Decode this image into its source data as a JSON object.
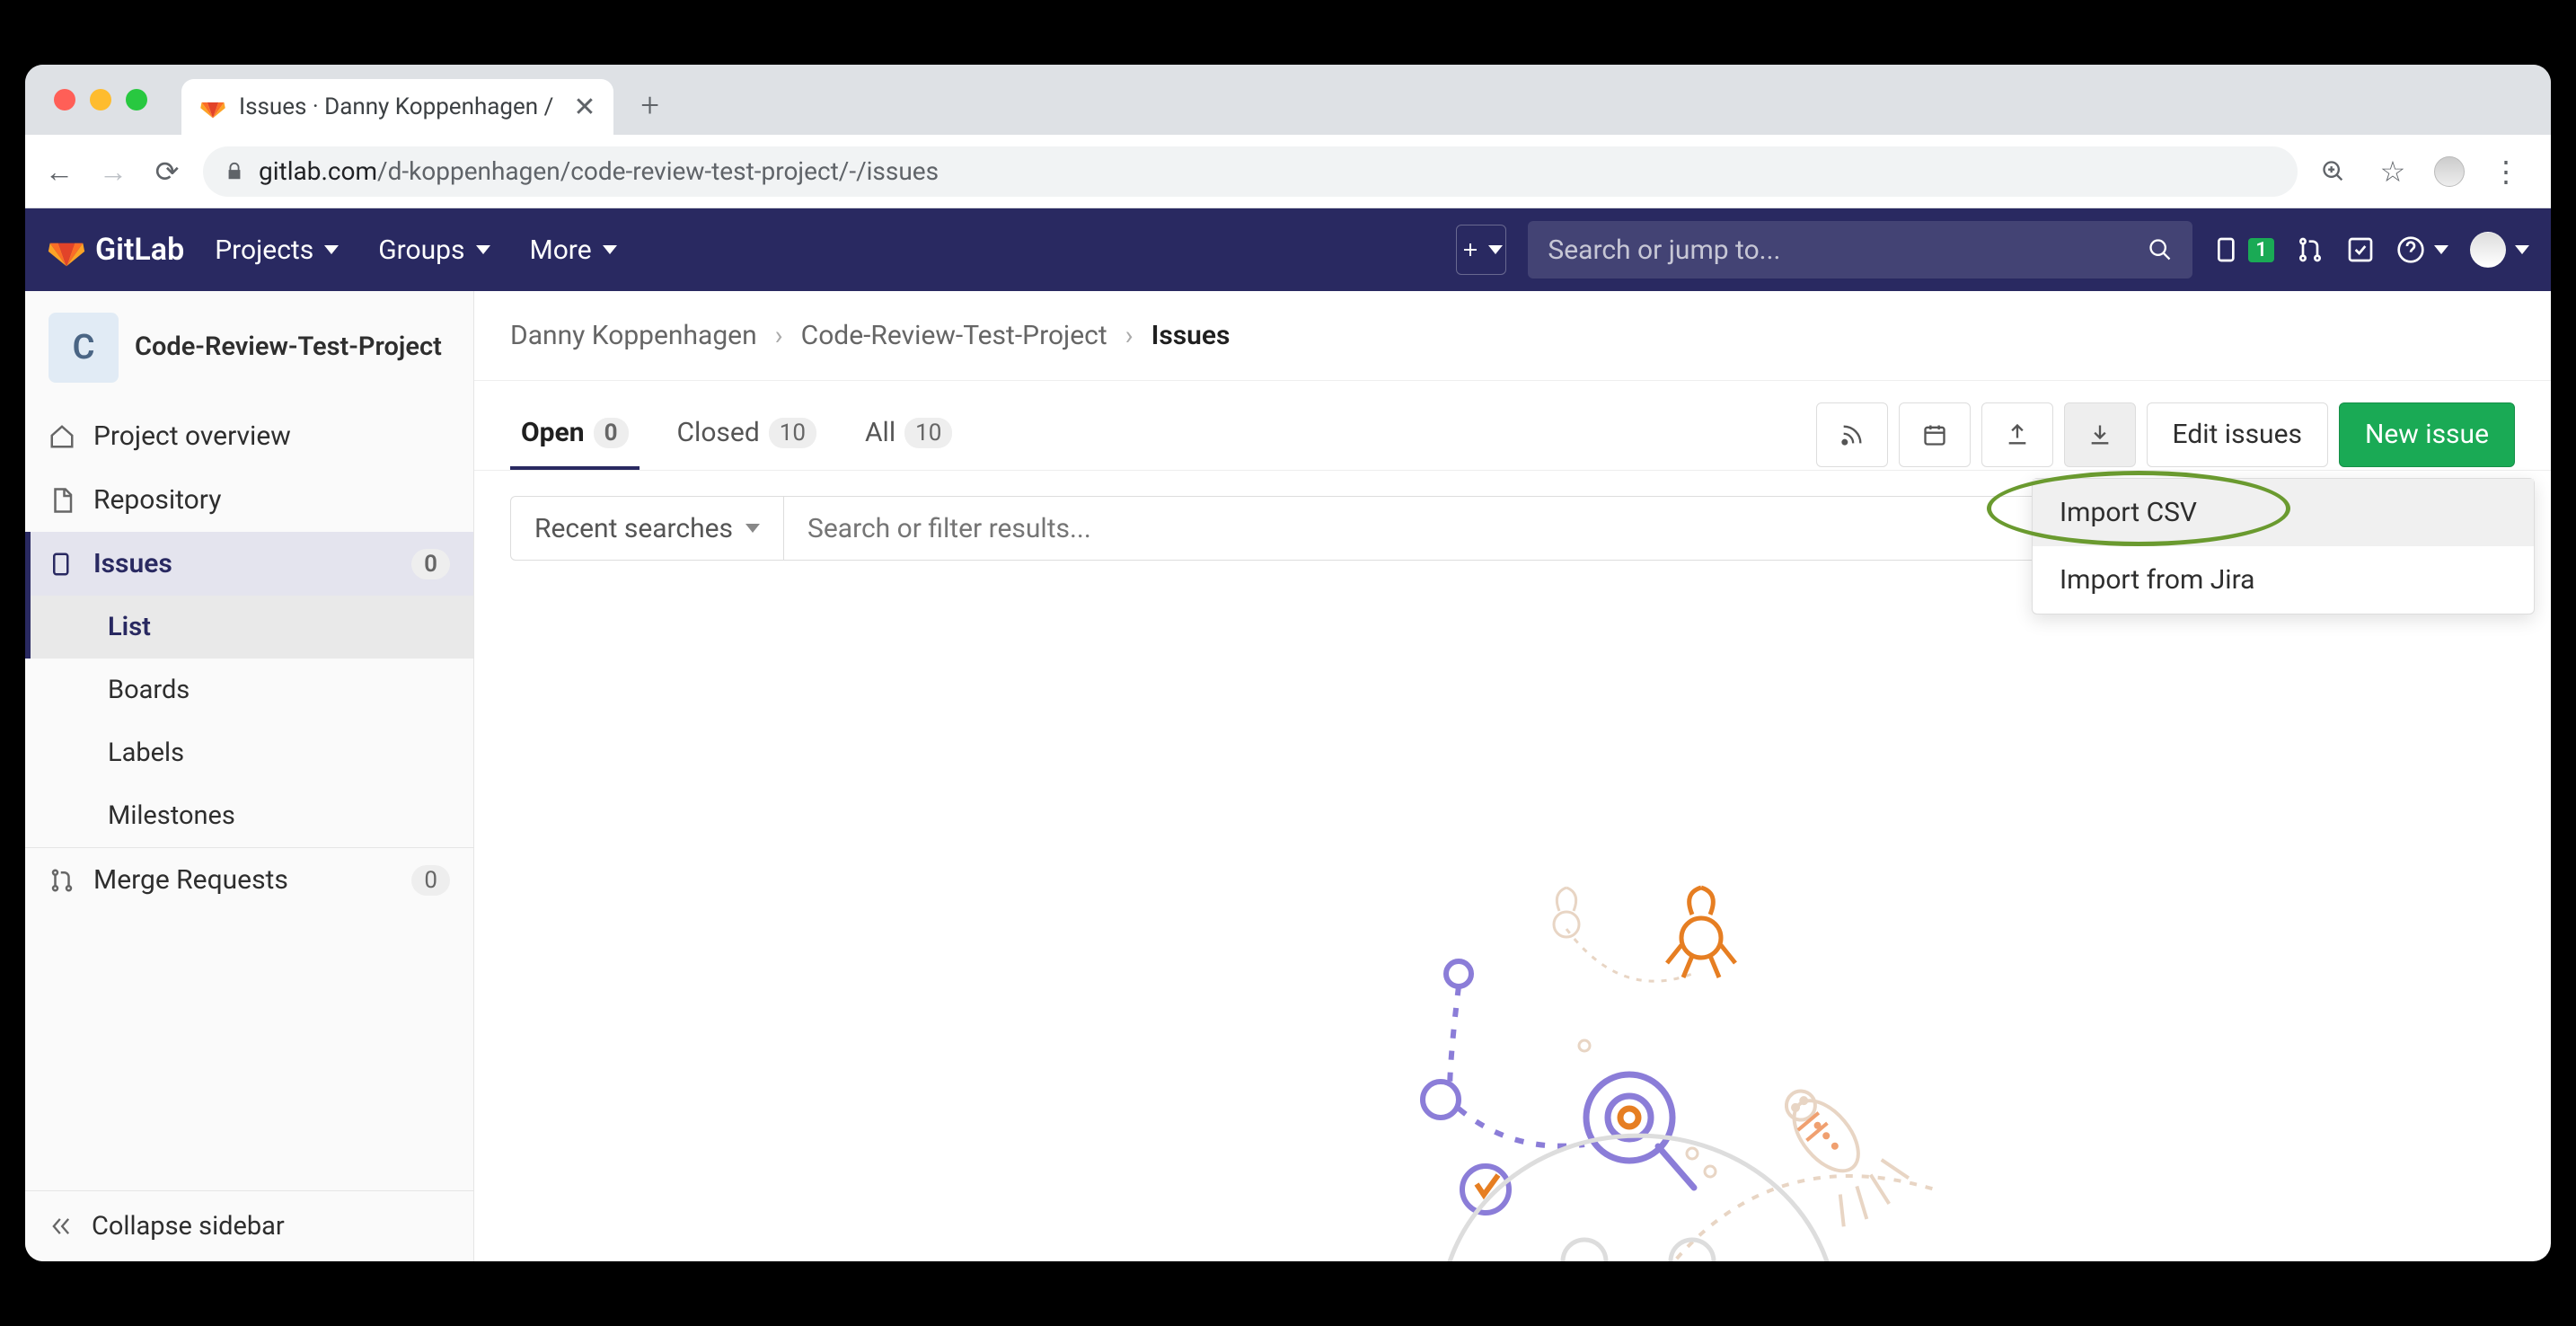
{
  "browser": {
    "tab_title": "Issues · Danny Koppenhagen /",
    "url_domain": "gitlab.com",
    "url_path": "/d-koppenhagen/code-review-test-project/-/issues"
  },
  "header": {
    "brand": "GitLab",
    "nav": {
      "projects": "Projects",
      "groups": "Groups",
      "more": "More"
    },
    "search_placeholder": "Search or jump to...",
    "issues_badge": "1"
  },
  "sidebar": {
    "project_initial": "C",
    "project_name": "Code-Review-Test-Project",
    "overview": "Project overview",
    "repository": "Repository",
    "issues": {
      "label": "Issues",
      "count": "0",
      "list": "List",
      "boards": "Boards",
      "labels": "Labels",
      "milestones": "Milestones"
    },
    "merge_requests": {
      "label": "Merge Requests",
      "count": "0"
    },
    "collapse": "Collapse sidebar"
  },
  "breadcrumb": {
    "owner": "Danny Koppenhagen",
    "project": "Code-Review-Test-Project",
    "page": "Issues"
  },
  "tabs": {
    "open": {
      "label": "Open",
      "count": "0"
    },
    "closed": {
      "label": "Closed",
      "count": "10"
    },
    "all": {
      "label": "All",
      "count": "10"
    }
  },
  "toolbar": {
    "edit": "Edit issues",
    "new": "New issue",
    "recent": "Recent searches",
    "filter_placeholder": "Search or filter results..."
  },
  "dropdown": {
    "csv": "Import CSV",
    "jira": "Import from Jira"
  }
}
